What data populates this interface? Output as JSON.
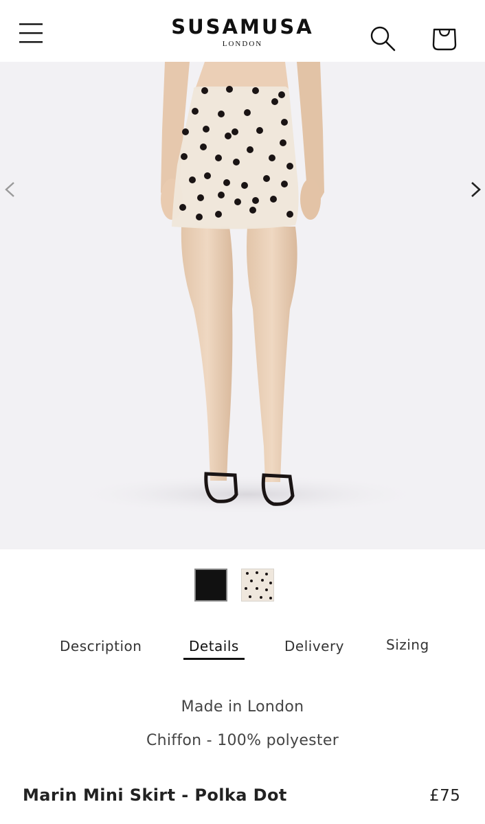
{
  "header": {
    "brand_name": "SUSAMUSA",
    "brand_sub": "LONDON",
    "icons": {
      "menu": "hamburger-menu-icon",
      "search": "search-icon",
      "cart": "shopping-bag-icon"
    }
  },
  "gallery": {
    "image": "model wearing polka dot sheer mini skirt with black sandals",
    "prev_icon": "chevron-left-icon",
    "next_icon": "chevron-right-icon"
  },
  "swatches": [
    {
      "name": "black"
    },
    {
      "name": "polka-dot"
    }
  ],
  "tabs": [
    {
      "label": "Description",
      "active": false
    },
    {
      "label": "Details",
      "active": true
    },
    {
      "label": "Delivery",
      "active": false
    },
    {
      "label": "Sizing",
      "active": false
    }
  ],
  "details": {
    "lines": [
      "Made in London",
      "Chiffon - 100% polyester"
    ]
  },
  "product": {
    "title": "Marin Mini Skirt - Polka Dot",
    "price": "£75"
  },
  "colors": {
    "gallery_bg": "#f2f1f4",
    "text": "#222222",
    "skirt": "#efe6da",
    "dot": "#1a1414"
  }
}
